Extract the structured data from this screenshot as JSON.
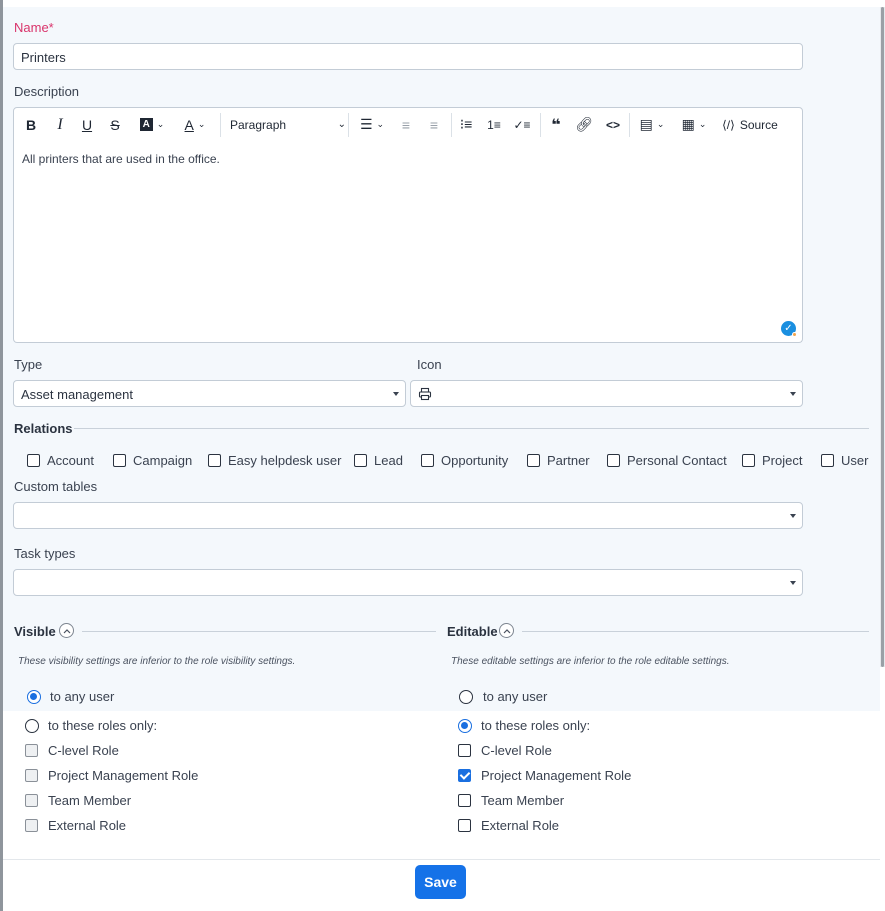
{
  "form": {
    "name_label": "Name*",
    "name_value": "Printers",
    "description_label": "Description",
    "description_text": "All printers that are used in the office.",
    "toolbar": {
      "bold": "B",
      "italic": "I",
      "underline": "U",
      "strike": "S",
      "paragraph": "Paragraph",
      "source": "Source"
    },
    "type_label": "Type",
    "type_value": "Asset management",
    "icon_label": "Icon",
    "icon_value": "printer-icon",
    "relations_title": "Relations",
    "relations": [
      {
        "label": "Account",
        "checked": false
      },
      {
        "label": "Campaign",
        "checked": false
      },
      {
        "label": "Easy helpdesk user",
        "checked": false
      },
      {
        "label": "Lead",
        "checked": false
      },
      {
        "label": "Opportunity",
        "checked": false
      },
      {
        "label": "Partner",
        "checked": false
      },
      {
        "label": "Personal Contact",
        "checked": false
      },
      {
        "label": "Project",
        "checked": false
      },
      {
        "label": "User",
        "checked": false
      }
    ],
    "custom_tables_label": "Custom tables",
    "custom_tables_value": "",
    "task_types_label": "Task types",
    "task_types_value": ""
  },
  "visible": {
    "title": "Visible",
    "note": "These visibility settings are inferior to the role visibility settings.",
    "radio_any": "to any user",
    "radio_roles": "to these roles only:",
    "selected": "any",
    "roles": [
      {
        "label": "C-level Role",
        "checked": false
      },
      {
        "label": "Project Management Role",
        "checked": false
      },
      {
        "label": "Team Member",
        "checked": false
      },
      {
        "label": "External Role",
        "checked": false
      }
    ]
  },
  "editable": {
    "title": "Editable",
    "note": "These editable settings are inferior to the role editable settings.",
    "radio_any": "to any user",
    "radio_roles": "to these roles only:",
    "selected": "roles",
    "roles": [
      {
        "label": "C-level Role",
        "checked": false
      },
      {
        "label": "Project Management Role",
        "checked": true
      },
      {
        "label": "Team Member",
        "checked": false
      },
      {
        "label": "External Role",
        "checked": false
      }
    ]
  },
  "footer": {
    "save_label": "Save"
  },
  "colors": {
    "accent": "#1572e8",
    "required": "#d9346b",
    "panel": "#f4f8fc"
  }
}
